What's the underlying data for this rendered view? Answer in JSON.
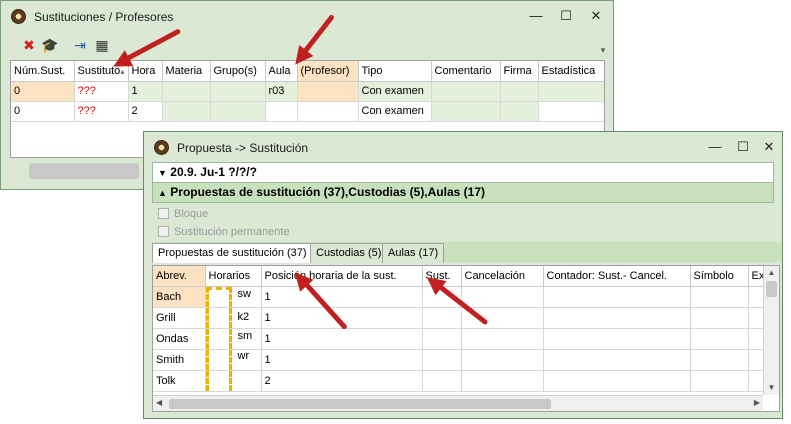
{
  "win1": {
    "title": "Sustituciones / Profesores",
    "controls": {
      "minimize": "—",
      "maximize": "☐",
      "close": "✕"
    },
    "toolbar": {
      "delete_icon": "✖",
      "teacher_icon": "🎓",
      "export_icon": "⇥",
      "calc_icon": "▦",
      "dropdown": "▾"
    },
    "columns": [
      "Núm.Sust.",
      "Sustituto",
      "Hora",
      "Materia",
      "Grupo(s)",
      "Aula",
      "(Profesor)",
      "Tipo",
      "Comentario",
      "Firma",
      "Estadística"
    ],
    "sort_marker": "▴",
    "rows": [
      [
        "0",
        "???",
        "1",
        "",
        "",
        "r03",
        "",
        "Con examen",
        "",
        "",
        ""
      ],
      [
        "0",
        "???",
        "2",
        "",
        "",
        "",
        "",
        "Con examen",
        "",
        "",
        ""
      ]
    ]
  },
  "win2": {
    "title": "Propuesta -> Sustitución",
    "controls": {
      "minimize": "—",
      "maximize": "☐",
      "close": "✕"
    },
    "section1": {
      "arrow": "▼",
      "label": "20.9. Ju-1 ?/?/?"
    },
    "section2": {
      "arrow": "▲",
      "label": "Propuestas de sustitución (37),Custodias (5),Aulas (17)"
    },
    "checkboxes": [
      "Bloque",
      "Sustitución permanente"
    ],
    "tabs": [
      "Propuestas de sustitución (37)",
      "Custodias (5)",
      "Aulas (17)"
    ],
    "columns": [
      "Abrev.",
      "Horarios",
      "Posición horaria de la sust.",
      "Sust.",
      "Cancelación",
      "Contador: Sust.- Cancel.",
      "Símbolo",
      "Ex"
    ],
    "rows": [
      {
        "abrev": "Bach",
        "code": "sw",
        "pos": "1"
      },
      {
        "abrev": "Grill",
        "code": "k2",
        "pos": "1"
      },
      {
        "abrev": "Ondas",
        "code": "sm",
        "pos": "1"
      },
      {
        "abrev": "Smith",
        "code": "wr",
        "pos": "1"
      },
      {
        "abrev": "Tolk",
        "code": "",
        "pos": "2"
      }
    ],
    "scroll": {
      "left": "◀",
      "right": "▶",
      "up": "▲",
      "down": "▼"
    }
  },
  "colors": {
    "window_bg": "#dbe8d3",
    "highlight": "#fde3c3",
    "row_alt": "#e4f0dc",
    "red_text": "#d01010",
    "arrow": "#c02020"
  }
}
